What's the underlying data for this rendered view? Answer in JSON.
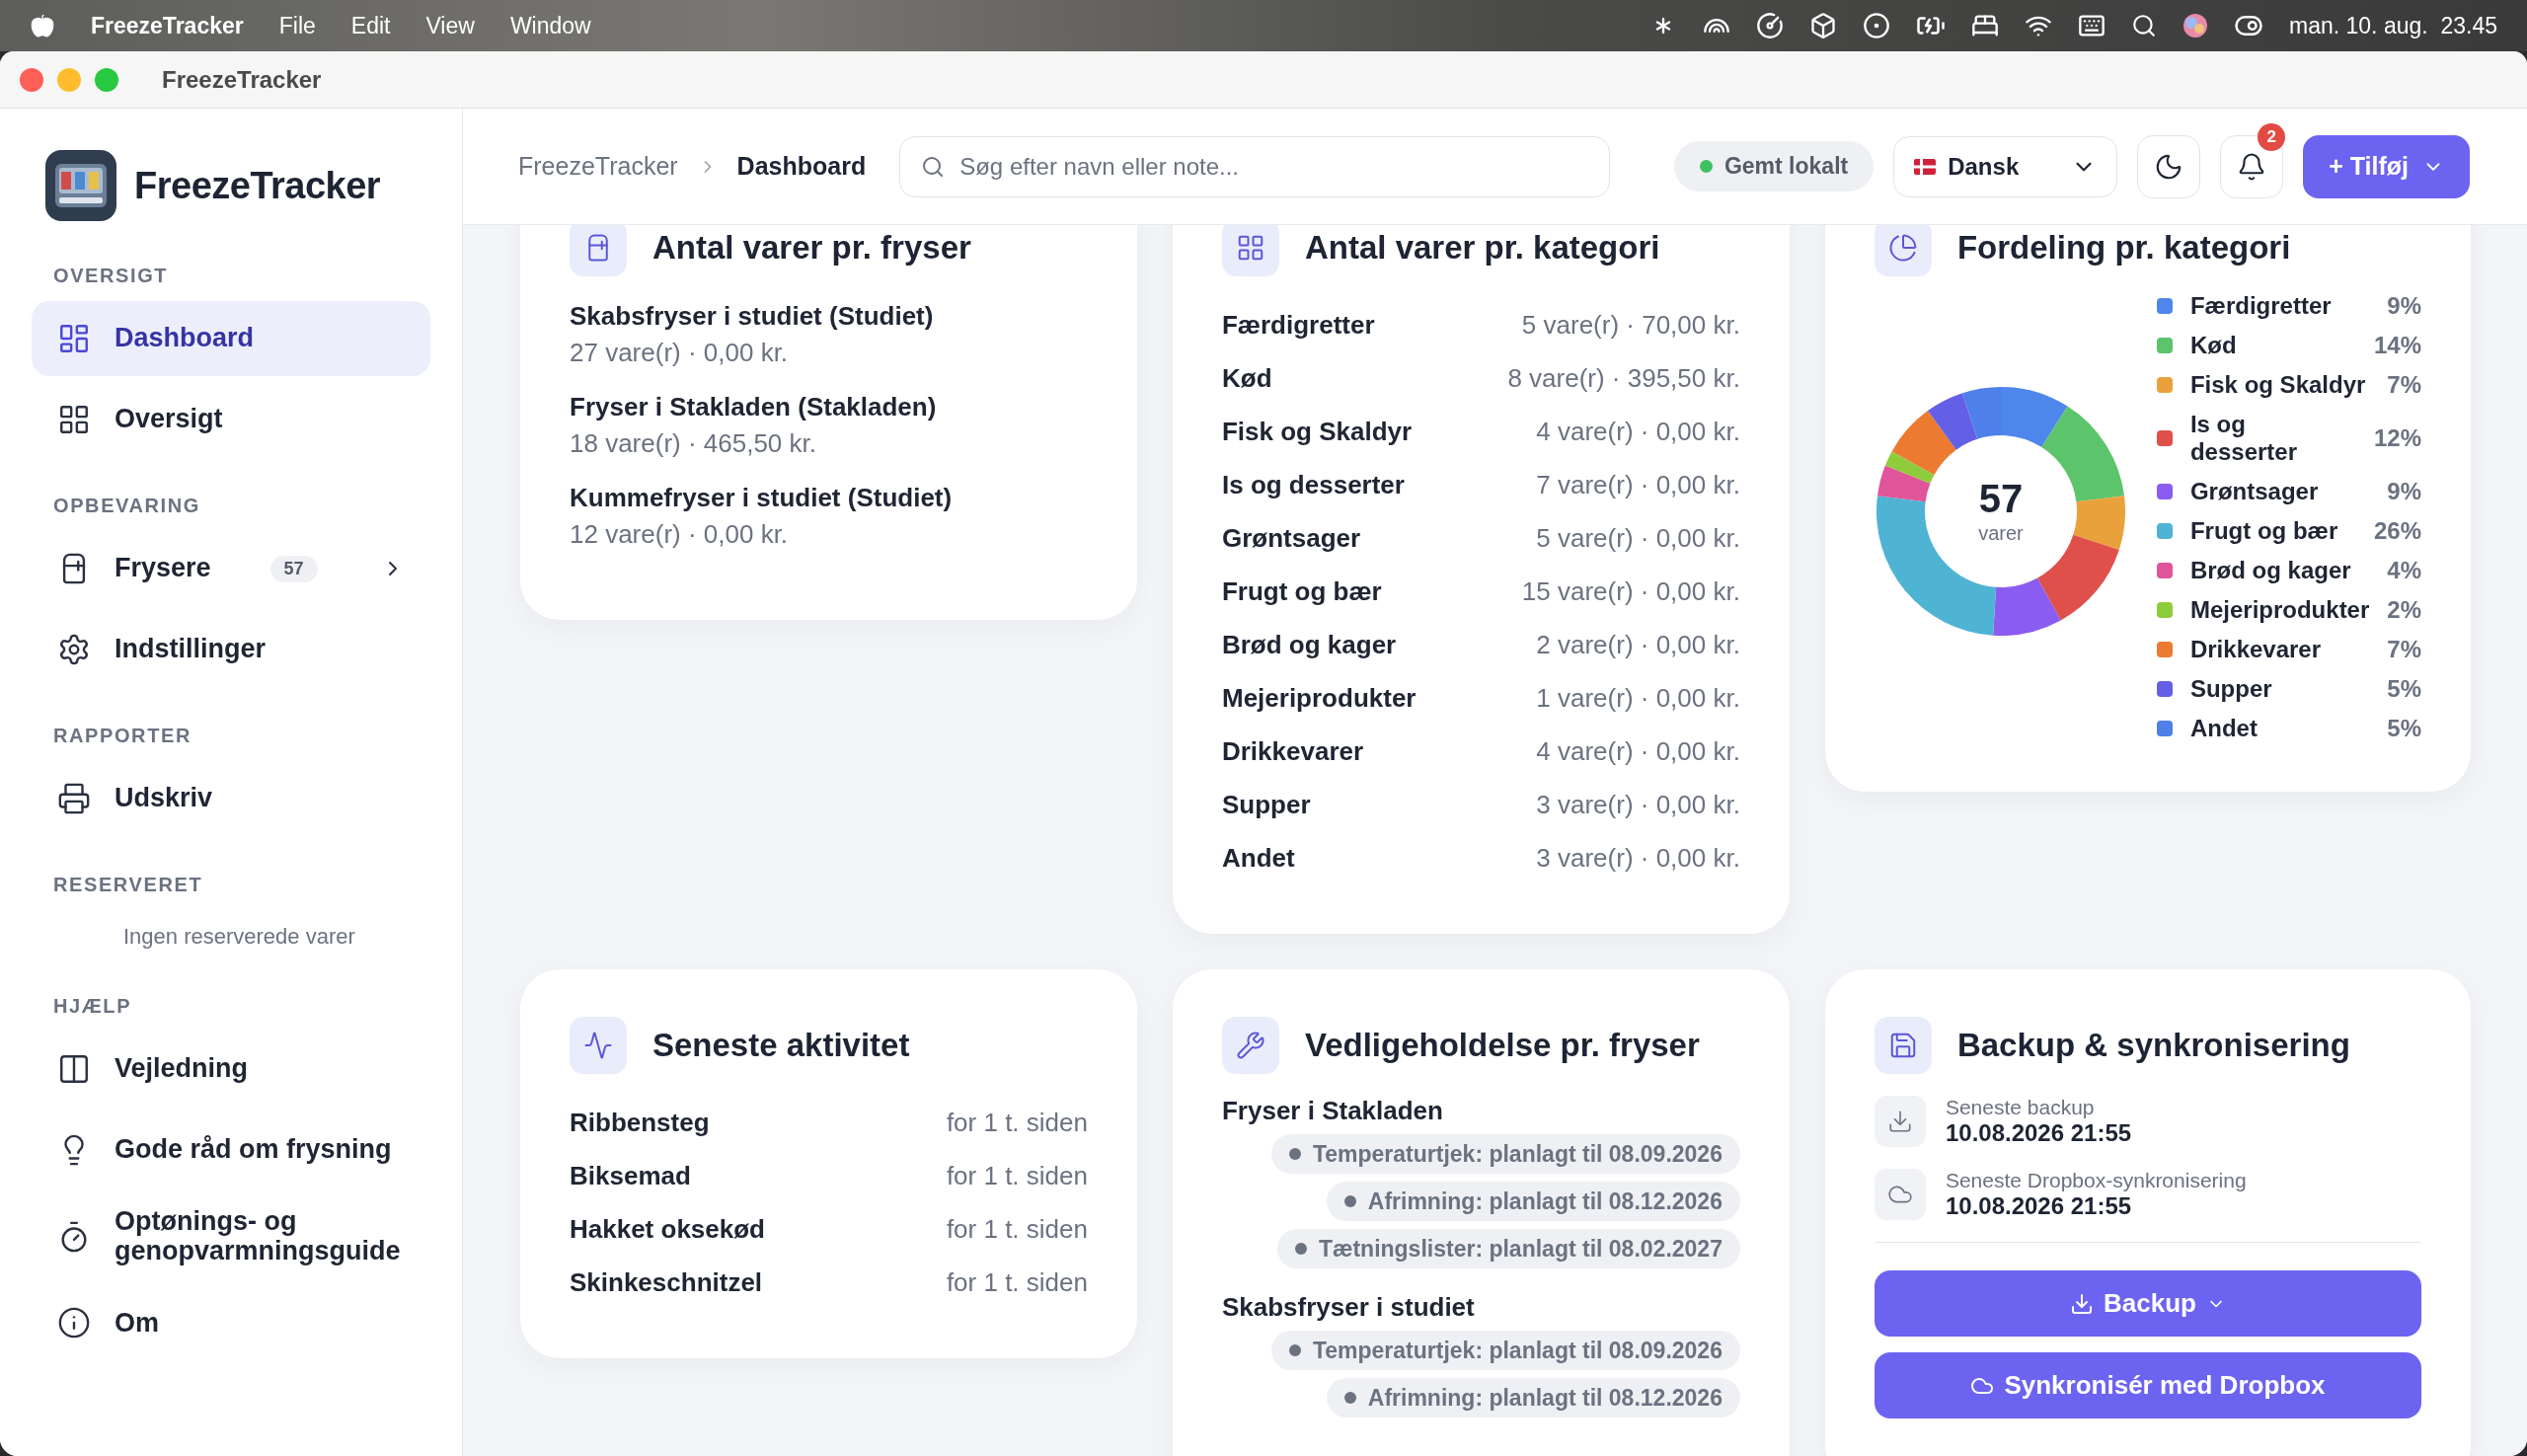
{
  "menubar": {
    "app": "FreezeTracker",
    "menus": [
      "File",
      "Edit",
      "View",
      "Window"
    ],
    "clock": "man. 10. aug.  23.45"
  },
  "window": {
    "title": "FreezeTracker"
  },
  "sidebar": {
    "brand": "FreezeTracker",
    "sections": [
      {
        "label": "OVERSIGT",
        "items": [
          {
            "label": "Dashboard",
            "kind": "link",
            "selected": true
          },
          {
            "label": "Oversigt",
            "kind": "link",
            "selected": false
          }
        ]
      },
      {
        "label": "OPBEVARING",
        "items": [
          {
            "label": "Frysere",
            "kind": "group",
            "badge": "57",
            "expanded": false,
            "selected": false
          },
          {
            "label": "Indstillinger",
            "kind": "link",
            "selected": false
          }
        ]
      },
      {
        "label": "RAPPORTER",
        "items": [
          {
            "label": "Udskriv",
            "kind": "link",
            "selected": false
          }
        ]
      },
      {
        "label": "RESERVERET",
        "empty_text": "Ingen reserverede varer"
      },
      {
        "label": "HJÆLP",
        "items": [
          {
            "label": "Vejledning",
            "kind": "link",
            "selected": false
          },
          {
            "label": "Gode råd om frysning",
            "kind": "link",
            "selected": false
          },
          {
            "label": "Optønings- og genopvarmningsguide",
            "kind": "link",
            "selected": false
          },
          {
            "label": "Om",
            "kind": "link",
            "selected": false
          }
        ]
      }
    ]
  },
  "header": {
    "breadcrumb": [
      "FreezeTracker",
      "Dashboard"
    ],
    "search": {
      "placeholder": "Søg efter navn eller note..."
    },
    "status": "Gemt lokalt",
    "language": "Dansk",
    "notifications": "2",
    "add_button": "+ Tilføj"
  },
  "per_freezer": {
    "title": "Antal varer pr. fryser",
    "items": [
      {
        "name": "Skabsfryser i studiet (Studiet)",
        "detail": "27 vare(r) · 0,00 kr."
      },
      {
        "name": "Fryser i Stakladen (Stakladen)",
        "detail": "18 vare(r) · 465,50 kr."
      },
      {
        "name": "Kummefryser i studiet (Studiet)",
        "detail": "12 vare(r) · 0,00 kr."
      }
    ]
  },
  "per_category": {
    "title": "Antal varer pr. kategori",
    "rows": [
      {
        "name": "Færdigretter",
        "detail": "5 vare(r) · 70,00 kr."
      },
      {
        "name": "Kød",
        "detail": "8 vare(r) · 395,50 kr."
      },
      {
        "name": "Fisk og Skaldyr",
        "detail": "4 vare(r) · 0,00 kr."
      },
      {
        "name": "Is og desserter",
        "detail": "7 vare(r) · 0,00 kr."
      },
      {
        "name": "Grøntsager",
        "detail": "5 vare(r) · 0,00 kr."
      },
      {
        "name": "Frugt og bær",
        "detail": "15 vare(r) · 0,00 kr."
      },
      {
        "name": "Brød og kager",
        "detail": "2 vare(r) · 0,00 kr."
      },
      {
        "name": "Mejeriprodukter",
        "detail": "1 vare(r) · 0,00 kr."
      },
      {
        "name": "Drikkevarer",
        "detail": "4 vare(r) · 0,00 kr."
      },
      {
        "name": "Supper",
        "detail": "3 vare(r) · 0,00 kr."
      },
      {
        "name": "Andet",
        "detail": "3 vare(r) · 0,00 kr."
      }
    ]
  },
  "distribution": {
    "title": "Fordeling pr. kategori",
    "center_value": "57",
    "center_label": "varer",
    "chart_data": {
      "type": "donut",
      "values": [
        9,
        14,
        7,
        12,
        9,
        26,
        4,
        2,
        7,
        5,
        5
      ]
    },
    "legend": [
      {
        "label": "Færdigretter",
        "percent": "9%",
        "color": "#4f86ec"
      },
      {
        "label": "Kød",
        "percent": "14%",
        "color": "#5cc46b"
      },
      {
        "label": "Fisk og Skaldyr",
        "percent": "7%",
        "color": "#e9a23b"
      },
      {
        "label": "Is og desserter",
        "percent": "12%",
        "color": "#e0504a"
      },
      {
        "label": "Grøntsager",
        "percent": "9%",
        "color": "#8b5cf0"
      },
      {
        "label": "Frugt og bær",
        "percent": "26%",
        "color": "#4fb3d4"
      },
      {
        "label": "Brød og kager",
        "percent": "4%",
        "color": "#e0559a"
      },
      {
        "label": "Mejeriprodukter",
        "percent": "2%",
        "color": "#8fcc3b"
      },
      {
        "label": "Drikkevarer",
        "percent": "7%",
        "color": "#ec7a30"
      },
      {
        "label": "Supper",
        "percent": "5%",
        "color": "#6360e6"
      },
      {
        "label": "Andet",
        "percent": "5%",
        "color": "#4f7fe8"
      }
    ]
  },
  "activity": {
    "title": "Seneste aktivitet",
    "rows": [
      {
        "name": "Ribbensteg",
        "time": "for 1 t. siden"
      },
      {
        "name": "Biksemad",
        "time": "for 1 t. siden"
      },
      {
        "name": "Hakket oksekød",
        "time": "for 1 t. siden"
      },
      {
        "name": "Skinkeschnitzel",
        "time": "for 1 t. siden"
      }
    ]
  },
  "maintenance": {
    "title": "Vedligeholdelse pr. fryser",
    "freezers": [
      {
        "name": "Fryser i Stakladen",
        "tasks": [
          "Temperaturtjek: planlagt til 08.09.2026",
          "Afrimning: planlagt til 08.12.2026",
          "Tætningslister: planlagt til 08.02.2027"
        ]
      },
      {
        "name": "Skabsfryser i studiet",
        "tasks": [
          "Temperaturtjek: planlagt til 08.09.2026",
          "Afrimning: planlagt til 08.12.2026"
        ]
      }
    ]
  },
  "backup": {
    "title": "Backup & synkronisering",
    "entries": [
      {
        "label": "Seneste backup",
        "value": "10.08.2026 21:55"
      },
      {
        "label": "Seneste Dropbox-synkronisering",
        "value": "10.08.2026 21:55"
      }
    ],
    "buttons": [
      "Backup",
      "Synkronisér med Dropbox"
    ]
  }
}
